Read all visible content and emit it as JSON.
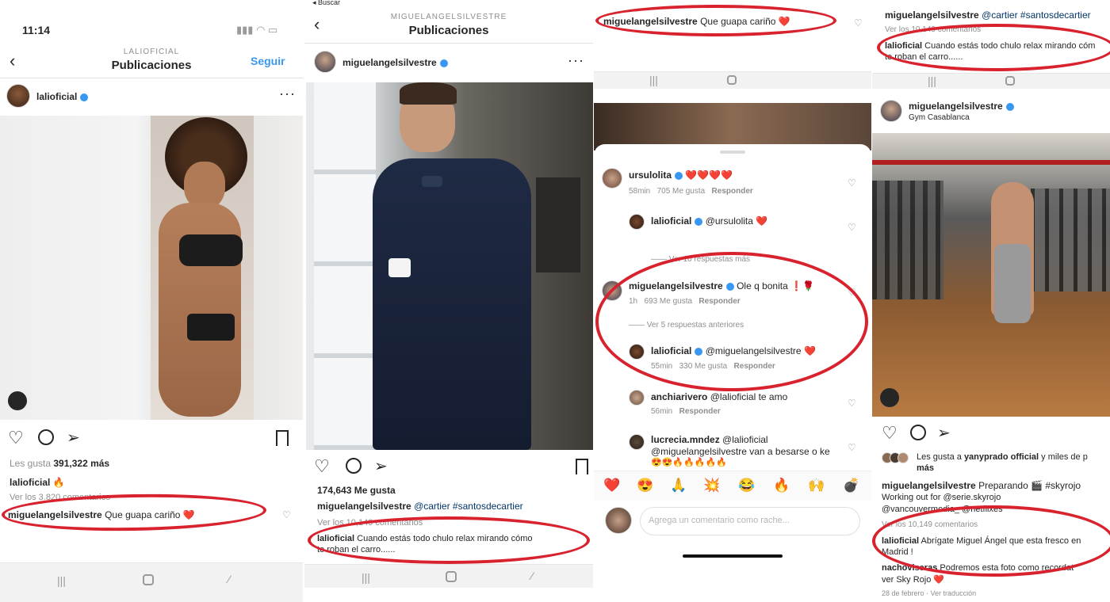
{
  "panel1": {
    "status_time": "11:14",
    "header_sub": "LALIOFICIAL",
    "header_title": "Publicaciones",
    "follow_label": "Seguir",
    "username": "lalioficial",
    "likes_text_a": "Les gusta ",
    "likes_text_b": "391,322 más",
    "caption_user": "lalioficial",
    "caption_emoji": "🔥",
    "view_comments": "Ver los 3.820 comentarios",
    "comment_user": "miguelangelsilvestre",
    "comment_text": "Que guapa cariño",
    "comment_emoji": "❤️"
  },
  "panel2": {
    "back_label": "◂ Buscar",
    "header_sub": "MIGUELANGELSILVESTRE",
    "header_title": "Publicaciones",
    "username": "miguelangelsilvestre",
    "likes": "174,643 Me gusta",
    "caption_user": "miguelangelsilvestre",
    "caption_tags": "@cartier #santosdecartier",
    "view_comments": "Ver los 10,149 comentarios",
    "comment_user": "lalioficial",
    "comment_text_1": "Cuando estás todo chulo relax mirando cómo",
    "comment_text_2": "te roban el carro......"
  },
  "panel3": {
    "top_comment_user": "miguelangelsilvestre",
    "top_comment_text": "Que guapa cariño",
    "comments": [
      {
        "user": "ursulolita",
        "text": "❤️❤️❤️❤️",
        "time": "58min",
        "likes": "705 Me gusta",
        "reply": "Responder"
      },
      {
        "user": "lalioficial",
        "text": "@ursulolita ❤️",
        "time": "",
        "likes": "",
        "reply": ""
      },
      {
        "user": "miguelangelsilvestre",
        "text": "Ole q bonita ❗🌹",
        "time": "1h",
        "likes": "693 Me gusta",
        "reply": "Responder"
      },
      {
        "user": "lalioficial",
        "text": "@miguelangelsilvestre ❤️",
        "time": "55min",
        "likes": "330 Me gusta",
        "reply": "Responder"
      },
      {
        "user": "anchiarivero",
        "text": "@lalioficial te amo",
        "time": "56min",
        "likes": "",
        "reply": "Responder"
      },
      {
        "user": "lucrecia.mndez",
        "text": "@lalioficial",
        "time": "",
        "likes": "",
        "reply": ""
      }
    ],
    "view_more_replies": "Ver 10 respuestas más",
    "view_prev_replies": "Ver 5 respuestas anteriores",
    "lucrecia_line2": "@miguelangelsilvestre van a besarse o ke",
    "lucrecia_line3": "😍😍🔥🔥🔥🔥🔥",
    "emoji_bar": [
      "❤️",
      "😍",
      "🙏",
      "💥",
      "😂",
      "🔥",
      "🙌",
      "💣"
    ],
    "input_placeholder": "Agrega un comentario como rache..."
  },
  "panel4": {
    "top_caption_user": "miguelangelsilvestre",
    "top_caption_tags": "@cartier #santosdecartier",
    "top_view_comments": "Ver los 10,149 comentarios",
    "top_comment_user": "lalioficial",
    "top_comment_text_1": "Cuando estás todo chulo relax mirando cóm",
    "top_comment_text_2": "te roban el carro......",
    "username": "miguelangelsilvestre",
    "location": "Gym Casablanca",
    "likes_prefix": "Les gusta a ",
    "likes_user": "yanyprado official",
    "likes_suffix": " y miles de p",
    "likes_more": "más",
    "caption_user": "miguelangelsilvestre",
    "caption_text": "Preparando 🎬 #skyrojo",
    "caption_line2": "Working out for @serie.skyrojo",
    "caption_line3": "@vancouvermedia_ @netflixes",
    "view_comments": "Ver los 10,149 comentarios",
    "comment_user": "lalioficial",
    "comment_text_1": "Abrígate Miguel Ángel que esta fresco en",
    "comment_text_2": "Madrid !",
    "reply_user": "nachoviseras",
    "reply_text_1": "Podremos esta foto como recordat",
    "reply_text_2": "ver Sky Rojo ❤️",
    "date": "28 de febrero",
    "translate": "Ver traducción"
  },
  "colors": {
    "accent": "#3897f0",
    "oval": "#d8232f",
    "heart": "#e0245e"
  }
}
